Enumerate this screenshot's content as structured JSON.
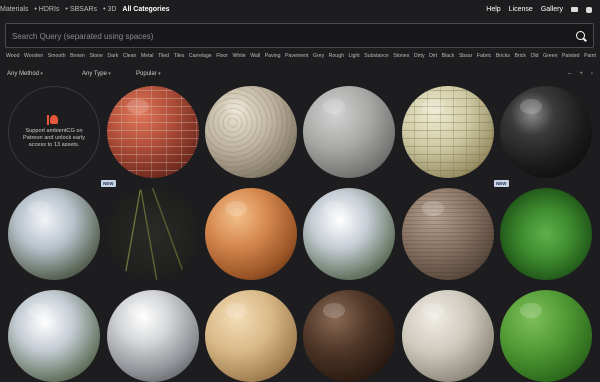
{
  "nav": {
    "left": [
      "Materials",
      "• HDRIs",
      "• SBSARs",
      "• 3D",
      "All Categories"
    ],
    "active_index": 4,
    "right": [
      "Help",
      "License",
      "Gallery"
    ]
  },
  "search": {
    "placeholder": "Search Query (separated using spaces)",
    "value": ""
  },
  "tags": [
    "Wood",
    "Wooden",
    "Smooth",
    "Brown",
    "Stone",
    "Dark",
    "Clean",
    "Metal",
    "Tiled",
    "Tiles",
    "Carrelage",
    "Floor",
    "White",
    "Wall",
    "Paving",
    "Pavement",
    "Grey",
    "Rough",
    "Light",
    "Substance",
    "Stones",
    "Dirty",
    "Dirt",
    "Black",
    "Sbsar",
    "Fabric",
    "Bricks",
    "Brick",
    "Old",
    "Green",
    "Painted",
    "Paint"
  ],
  "filters": {
    "method": "Any Method",
    "type": "Any Type",
    "sort": "Popular"
  },
  "promo": {
    "text": "Support ambientCG on Patreon and unlock early access to 13 assets."
  },
  "badge_label": "NEW",
  "grid": [
    {
      "material": "brick-red"
    },
    {
      "material": "cobblestone"
    },
    {
      "material": "concrete"
    },
    {
      "material": "cream-brick"
    },
    {
      "material": "black-plastic"
    },
    {
      "material": "hdri-reflective"
    },
    {
      "material": "grass-branch",
      "badge": true
    },
    {
      "material": "wood-light"
    },
    {
      "material": "hdri-reflective-2"
    },
    {
      "material": "wood-grey"
    },
    {
      "material": "leaves",
      "badge": true
    },
    {
      "material": "metal-scratched"
    },
    {
      "material": "sand"
    },
    {
      "material": "wood-dark"
    },
    {
      "material": "gravel"
    },
    {
      "material": "grass-turf"
    }
  ]
}
